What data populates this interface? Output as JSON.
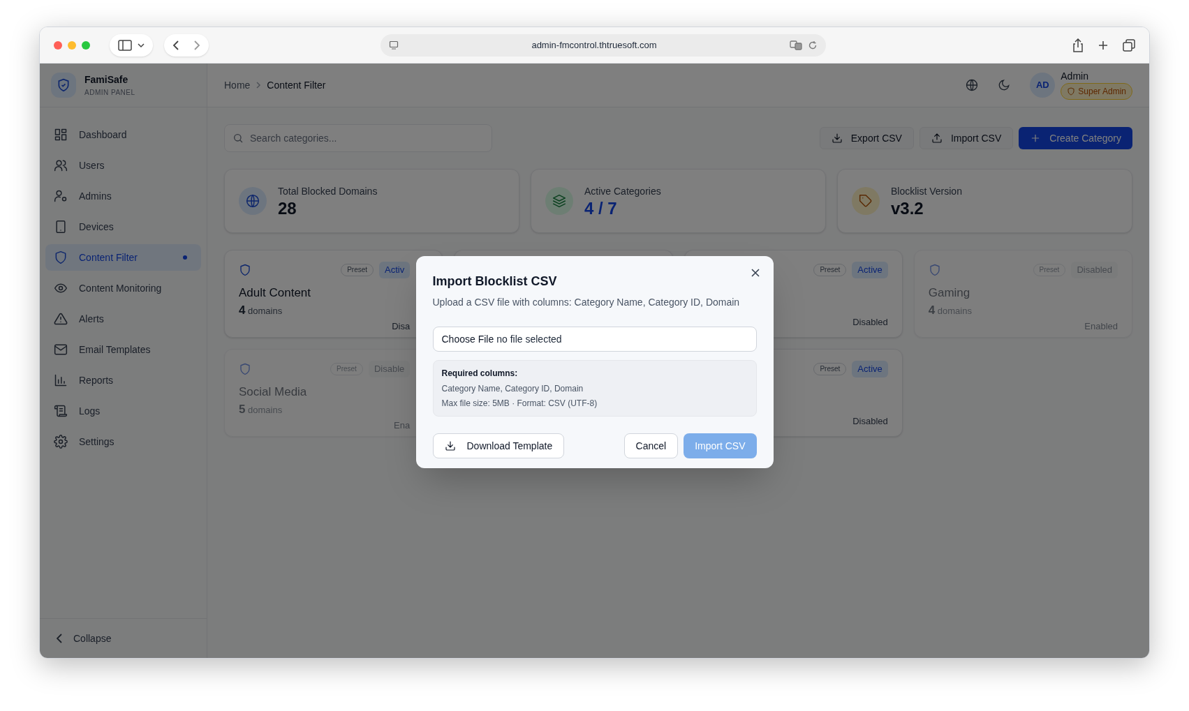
{
  "browser": {
    "url": "admin-fmcontrol.thtruesoft.com"
  },
  "sidebar": {
    "brand": {
      "name": "FamiSafe",
      "subtitle": "ADMIN PANEL"
    },
    "items": [
      {
        "label": "Dashboard",
        "selected": false
      },
      {
        "label": "Users",
        "selected": false
      },
      {
        "label": "Admins",
        "selected": false
      },
      {
        "label": "Devices",
        "selected": false
      },
      {
        "label": "Content Filter",
        "selected": true
      },
      {
        "label": "Content Monitoring",
        "selected": false
      },
      {
        "label": "Alerts",
        "selected": false
      },
      {
        "label": "Email Templates",
        "selected": false
      },
      {
        "label": "Reports",
        "selected": false
      },
      {
        "label": "Logs",
        "selected": false
      },
      {
        "label": "Settings",
        "selected": false
      }
    ],
    "collapse": "Collapse"
  },
  "header": {
    "breadcrumb": [
      "Home",
      "Content Filter"
    ],
    "user": {
      "initials": "AD",
      "name": "Admin",
      "role": "Super Admin"
    }
  },
  "toolbar": {
    "search": {
      "placeholder": "Search categories..."
    },
    "buttons": [
      {
        "label": "Export CSV",
        "kind": "export"
      },
      {
        "label": "Import CSV",
        "kind": "import"
      },
      {
        "label": "Create Category",
        "kind": "create"
      }
    ]
  },
  "stats": [
    {
      "label": "Total Blocked Domains",
      "value": "28",
      "kind": "globe"
    },
    {
      "label": "Active Categories",
      "value": "4 / 7",
      "kind": "layers"
    },
    {
      "label": "Blocklist Version",
      "value": "v3.2",
      "kind": "tag"
    }
  ],
  "categories": [
    {
      "kind": "card",
      "preset": "Preset",
      "status": "Activ",
      "active": true,
      "name": "Adult Content",
      "count": "4",
      "unit": "domains",
      "footer": "Disa"
    },
    {
      "kind": "covered"
    },
    {
      "kind": "card",
      "preset": "Preset",
      "status": "Active",
      "active": true,
      "footer": "Disabled"
    },
    {
      "kind": "card",
      "preset": "Preset",
      "status": "Disabled",
      "active": false,
      "name": "Gaming",
      "count": "4",
      "unit": "domains",
      "footer": "Enabled"
    },
    {
      "kind": "card",
      "preset": "Preset",
      "status": "Disable",
      "active": false,
      "name": "Social Media",
      "count": "5",
      "unit": "domains",
      "footer": "Ena"
    },
    {
      "kind": "hidden"
    },
    {
      "kind": "card",
      "preset": "Preset",
      "status": "Active",
      "active": true,
      "footer": "Disabled"
    }
  ],
  "modal": {
    "title": "Import Blocklist CSV",
    "description": "Upload a CSV file with columns: Category Name, Category ID, Domain",
    "file": {
      "button": "Choose File",
      "text": "no file selected"
    },
    "info": {
      "heading": "Required columns:",
      "lines": [
        "Category Name, Category ID, Domain",
        "Max file size: 5MB · Format: CSV (UTF-8)"
      ]
    },
    "buttons": [
      {
        "label": "Download Template",
        "kind": "download"
      },
      {
        "label": "Cancel",
        "kind": "cancel"
      },
      {
        "label": "Import CSV",
        "kind": "primary",
        "disabled": true
      }
    ]
  }
}
